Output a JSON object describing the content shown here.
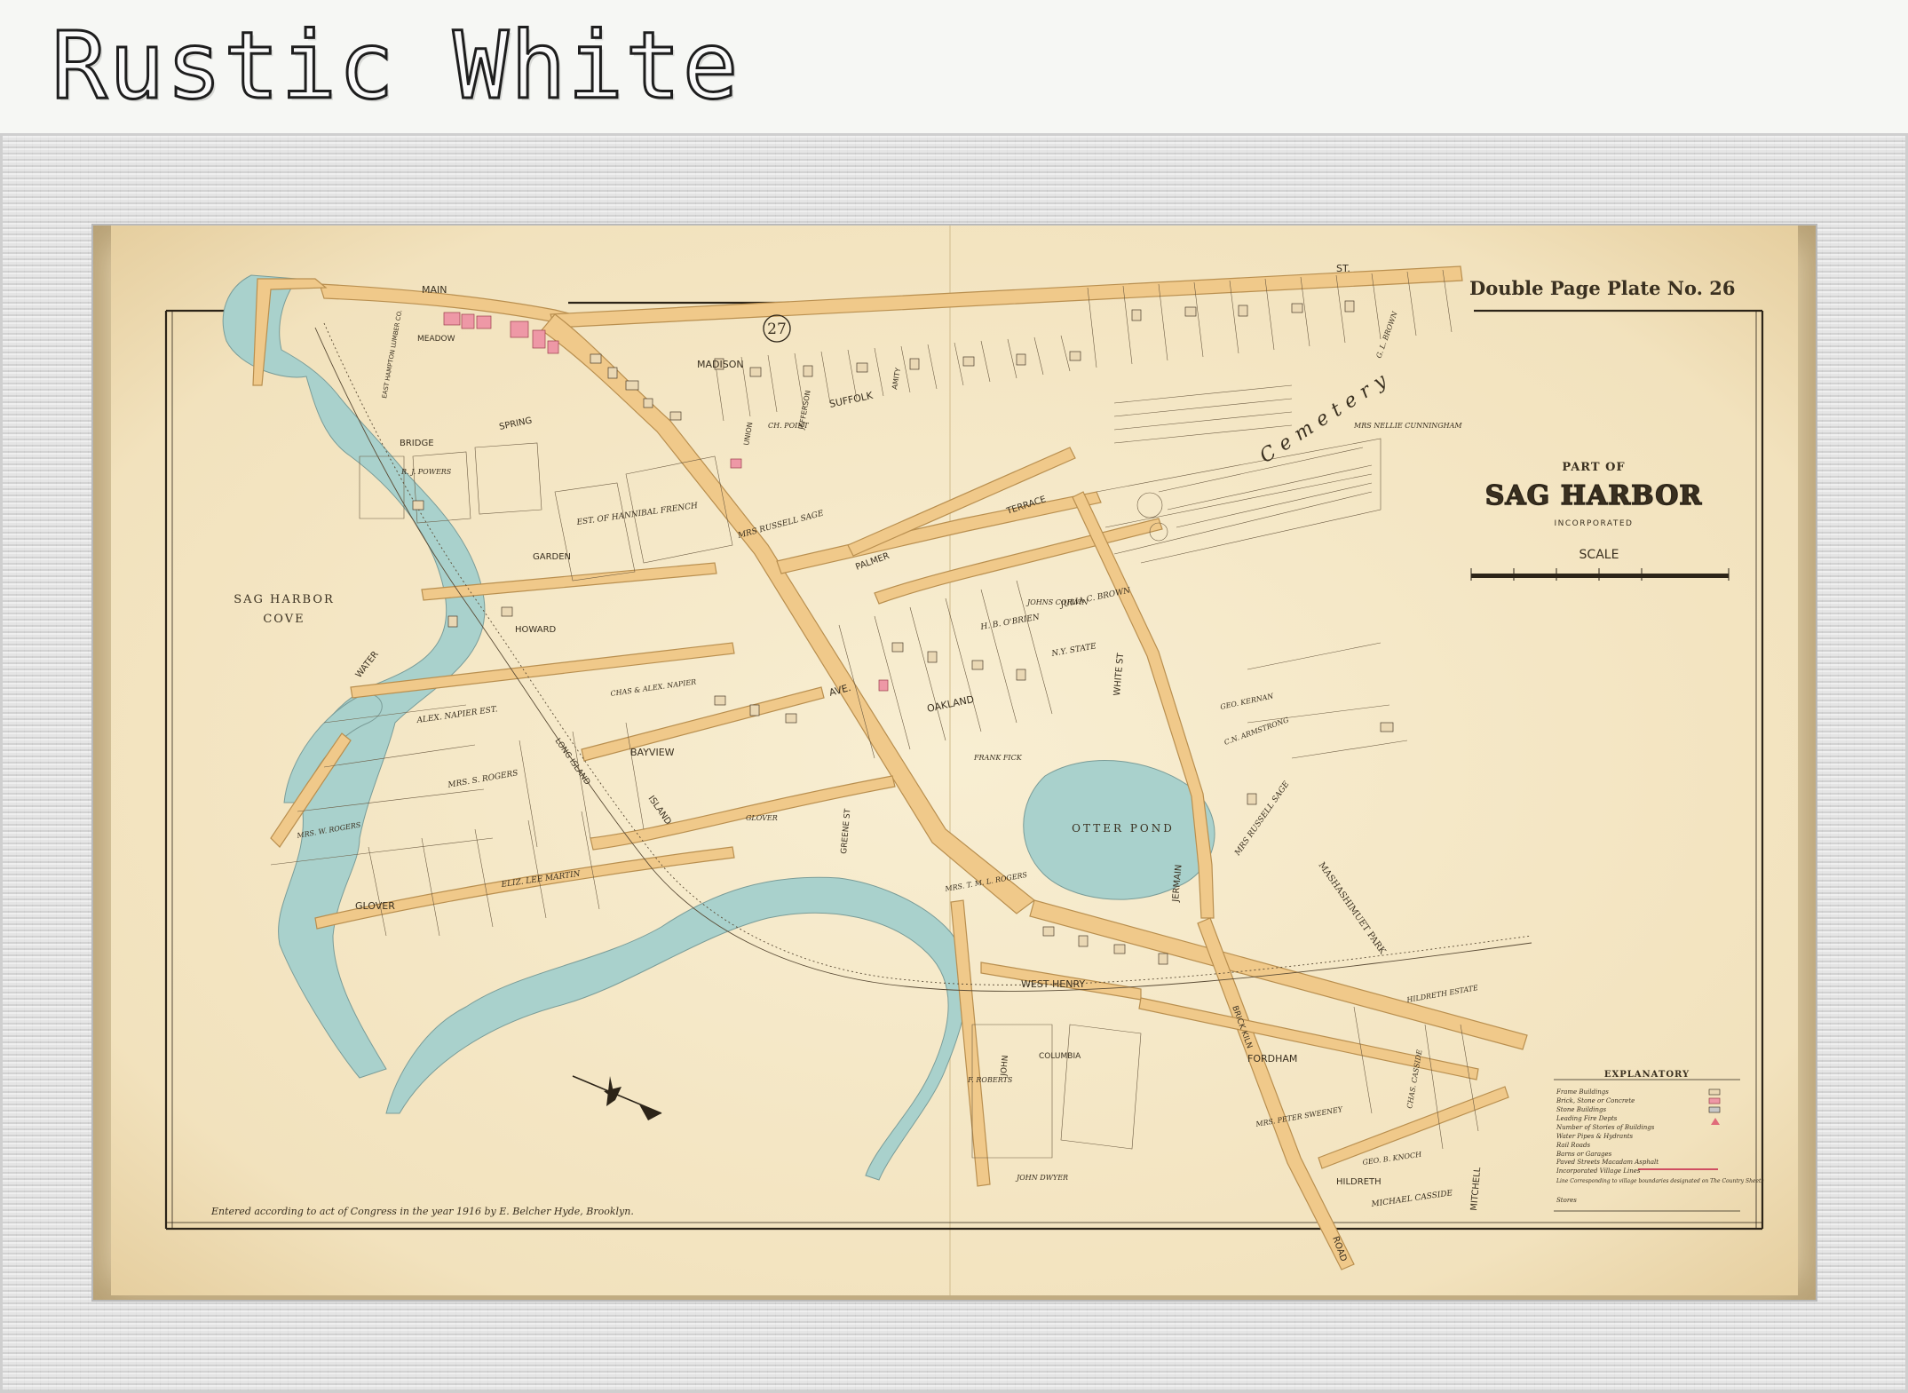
{
  "header": {
    "title": "Rustic White"
  },
  "map": {
    "plate": "Double Page Plate No. 26",
    "ward_number": "27",
    "title_small": "PART OF",
    "title_main": "SAG HARBOR",
    "title_sub": "INCORPORATED",
    "scale_label": "SCALE",
    "credit": "Entered according to act of Congress in the year 1916 by E. Belcher Hyde, Brooklyn.",
    "water_labels": [
      "SAG HARBOR",
      "COVE",
      "OTTER POND"
    ],
    "cemetery_label": "Cemetery",
    "park_label": "MASHASHIMUET PARK",
    "streets": [
      "MAIN",
      "ST.",
      "MEADOW",
      "MADISON",
      "SUFFOLK",
      "BRIDGE",
      "SPRING",
      "GARDEN",
      "HOWARD",
      "PALMER",
      "TERRACE",
      "WATER",
      "BAYVIEW",
      "AVE.",
      "OAKLAND",
      "GLOVER",
      "ISLAND",
      "WHITE ST",
      "JERMAIN",
      "WEST HENRY",
      "COLUMBIA",
      "JOHN",
      "FORDHAM",
      "HILDRETH",
      "MITCHELL",
      "ROAD",
      "BRICK KILN",
      "GREENE ST",
      "AMITY",
      "UNION",
      "JEFFERSON",
      "LONG ISLAND"
    ],
    "owners": [
      "EAST HAMPTON LUMBER CO.",
      "EST. OF HANNIBAL FRENCH",
      "MRS RUSSELL SAGE",
      "ALEX. NAPIER EST.",
      "CHAS & ALEX. NAPIER",
      "MRS. S. ROGERS",
      "ELIZ. LEE MARTIN",
      "H. B. O'BRIEN",
      "N.Y. STATE",
      "MRS RUSSELL SAGE",
      "JULIA C. BROWN",
      "GEO. KERNAN",
      "C.N. ARMSTRONG",
      "MRS NELLIE CUNNINGHAM",
      "MICHAEL CASSIDE",
      "JOHN DWYER",
      "MRS. W. ROGERS",
      "GEO. B. KNOCH",
      "CHAS. CASSIDE",
      "HILDRETH ESTATE",
      "MRS. PETER SWEENEY",
      "CH. POINT",
      "MRS. T. M. L. ROGERS",
      "R. J. POWERS",
      "GLOVER",
      "FRANK FICK",
      "JOHNS CORWIN",
      "F. ROBERTS",
      "G. L. BROWN"
    ],
    "legend": {
      "title": "EXPLANATORY",
      "items": [
        "Frame Buildings",
        "Brick, Stone or Concrete",
        "Stone Buildings",
        "Leading Fire Depts",
        "Number of Stories of Buildings",
        "Water Pipes & Hydrants",
        "Rail Roads",
        "Barns or Garages",
        "Paved Streets Macadam Asphalt",
        "Incorporated Village Lines",
        "Line Corresponding to village boundaries designated on The Country Sheets",
        "Stores"
      ]
    }
  },
  "colors": {
    "paper": "#f7ebcc",
    "water": "#a9d1cc",
    "road": "#f0c98a",
    "brick_buildings": "#ee98a6",
    "ink": "#3a3020",
    "mat": "#e9d8b3",
    "frame": "#dcdcdc"
  }
}
